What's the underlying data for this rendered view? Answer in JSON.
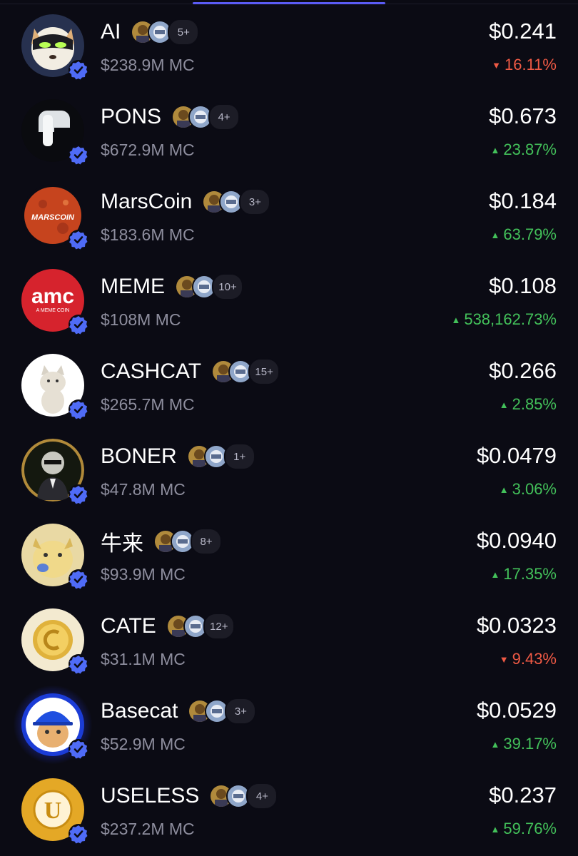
{
  "tabs": {
    "active_index": 1
  },
  "colors": {
    "up": "#43c15a",
    "down": "#f05a45",
    "accent": "#5b5cf6",
    "verified": "#4f6bf6"
  },
  "tokens": [
    {
      "name": "AI",
      "holders_more": "5+",
      "market_cap": "$238.9M MC",
      "price": "$0.241",
      "change": "16.11%",
      "direction": "down",
      "avatar_icon": "dog-mask-icon"
    },
    {
      "name": "PONS",
      "holders_more": "4+",
      "market_cap": "$672.9M MC",
      "price": "$0.673",
      "change": "23.87%",
      "direction": "up",
      "avatar_icon": "p-letter-icon"
    },
    {
      "name": "MarsCoin",
      "holders_more": "3+",
      "market_cap": "$183.6M MC",
      "price": "$0.184",
      "change": "63.79%",
      "direction": "up",
      "avatar_icon": "mars-planet-icon",
      "avatar_text": "MARSCOIN"
    },
    {
      "name": "MEME",
      "holders_more": "10+",
      "market_cap": "$108M MC",
      "price": "$0.108",
      "change": "538,162.73%",
      "direction": "up",
      "avatar_icon": "amc-logo-icon",
      "avatar_text": "amc",
      "avatar_subtext": "A MEME COIN"
    },
    {
      "name": "CASHCAT",
      "holders_more": "15+",
      "market_cap": "$265.7M MC",
      "price": "$0.266",
      "change": "2.85%",
      "direction": "up",
      "avatar_icon": "cat-icon"
    },
    {
      "name": "BONER",
      "holders_more": "1+",
      "market_cap": "$47.8M MC",
      "price": "$0.0479",
      "change": "3.06%",
      "direction": "up",
      "avatar_icon": "statue-bust-icon"
    },
    {
      "name": "牛来",
      "holders_more": "8+",
      "market_cap": "$93.9M MC",
      "price": "$0.0940",
      "change": "17.35%",
      "direction": "up",
      "avatar_icon": "bull-creature-icon"
    },
    {
      "name": "CATE",
      "holders_more": "12+",
      "market_cap": "$31.1M MC",
      "price": "$0.0323",
      "change": "9.43%",
      "direction": "down",
      "avatar_icon": "gold-coin-icon"
    },
    {
      "name": "Basecat",
      "holders_more": "3+",
      "market_cap": "$52.9M MC",
      "price": "$0.0529",
      "change": "39.17%",
      "direction": "up",
      "avatar_icon": "hardhat-cat-icon"
    },
    {
      "name": "USELESS",
      "holders_more": "4+",
      "market_cap": "$237.2M MC",
      "price": "$0.237",
      "change": "59.76%",
      "direction": "up",
      "avatar_icon": "u-coin-icon",
      "avatar_text": "U"
    }
  ]
}
